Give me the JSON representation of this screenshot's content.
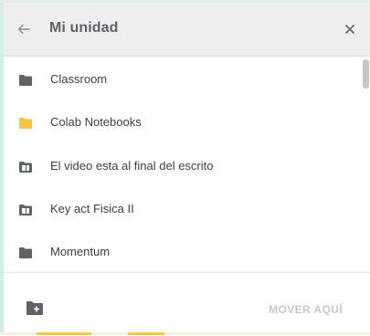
{
  "header": {
    "title": "Mi unidad",
    "back_icon": "arrow-back-icon",
    "close_icon": "close-icon"
  },
  "items": [
    {
      "label": "Classroom",
      "icon": "folder-icon",
      "color": "#5f6368"
    },
    {
      "label": "Colab Notebooks",
      "icon": "folder-icon",
      "color": "#f4c542"
    },
    {
      "label": "El video esta al final del escrito",
      "icon": "shared-folder-icon",
      "color": "#5f6368"
    },
    {
      "label": "Key act Fisica II",
      "icon": "shared-folder-icon",
      "color": "#5f6368"
    },
    {
      "label": "Momentum",
      "icon": "folder-icon",
      "color": "#5f6368"
    }
  ],
  "footer": {
    "new_folder_icon": "new-folder-icon",
    "move_label": "MOVER AQUÍ"
  },
  "colors": {
    "header_bg": "#eeeeee",
    "disabled_text": "#c8c8c8",
    "folder_yellow": "#f4c542",
    "icon_gray": "#5f6368"
  }
}
